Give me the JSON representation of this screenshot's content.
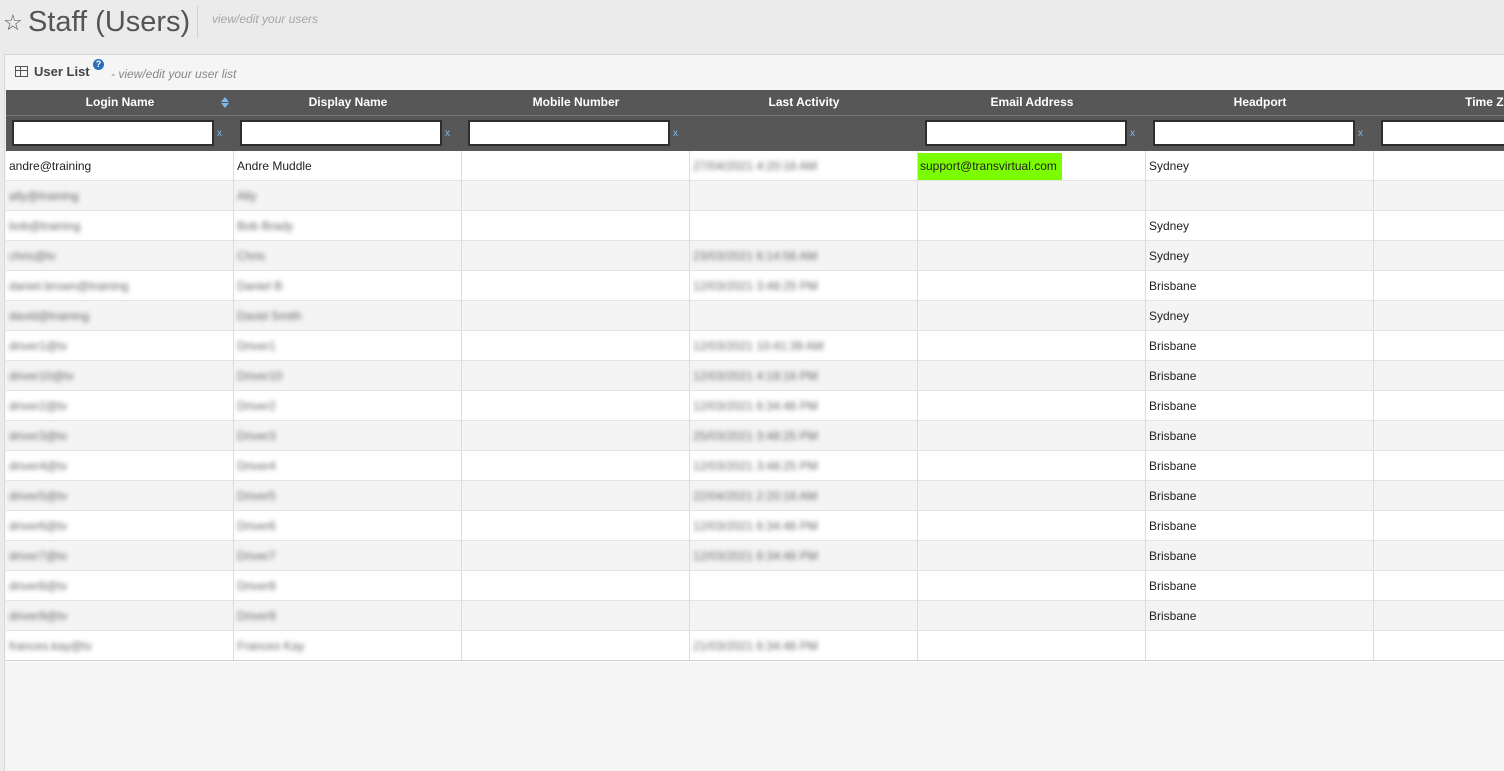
{
  "page": {
    "title": "Staff (Users)",
    "subtitle": "view/edit your users",
    "star_icon": "star-icon"
  },
  "panel": {
    "title": "User List",
    "subtitle": "- view/edit your user list",
    "help_icon": "?"
  },
  "columns": [
    "Login Name",
    "Display Name",
    "Mobile Number",
    "Last Activity",
    "Email Address",
    "Headport",
    "Time Zo"
  ],
  "filter_clear": "x",
  "colors": {
    "header_bg": "#575757",
    "highlight": "#7cfc00",
    "accent": "#2a6ebb"
  },
  "rows": [
    {
      "login": "andre@training",
      "display": "Andre Muddle",
      "mobile": "",
      "activity": "27/04/2021 4:20:16 AM",
      "email": "support@transvirtual.com",
      "headport": "Sydney"
    },
    {
      "login": "ally@training",
      "display": "Ally",
      "mobile": "",
      "activity": "",
      "email": "",
      "headport": ""
    },
    {
      "login": "bob@training",
      "display": "Bob Brady",
      "mobile": "",
      "activity": "",
      "email": "",
      "headport": "Sydney"
    },
    {
      "login": "chris@tv",
      "display": "Chris",
      "mobile": "",
      "activity": "23/03/2021 6:14:56 AM",
      "email": "",
      "headport": "Sydney"
    },
    {
      "login": "daniel.brown@training",
      "display": "Daniel B",
      "mobile": "",
      "activity": "12/03/2021 3:48:25 PM",
      "email": "",
      "headport": "Brisbane"
    },
    {
      "login": "david@training",
      "display": "David Smith",
      "mobile": "",
      "activity": "",
      "email": "",
      "headport": "Sydney"
    },
    {
      "login": "driver1@tv",
      "display": "Driver1",
      "mobile": "",
      "activity": "12/03/2021 10:41:39 AM",
      "email": "",
      "headport": "Brisbane"
    },
    {
      "login": "driver10@tv",
      "display": "Driver10",
      "mobile": "",
      "activity": "12/03/2021 4:18:16 PM",
      "email": "",
      "headport": "Brisbane"
    },
    {
      "login": "driver2@tv",
      "display": "Driver2",
      "mobile": "",
      "activity": "12/03/2021 6:34:46 PM",
      "email": "",
      "headport": "Brisbane"
    },
    {
      "login": "driver3@tv",
      "display": "Driver3",
      "mobile": "",
      "activity": "25/03/2021 3:48:25 PM",
      "email": "",
      "headport": "Brisbane"
    },
    {
      "login": "driver4@tv",
      "display": "Driver4",
      "mobile": "",
      "activity": "12/03/2021 3:48:25 PM",
      "email": "",
      "headport": "Brisbane"
    },
    {
      "login": "driver5@tv",
      "display": "Driver5",
      "mobile": "",
      "activity": "22/04/2021 2:20:16 AM",
      "email": "",
      "headport": "Brisbane"
    },
    {
      "login": "driver6@tv",
      "display": "Driver6",
      "mobile": "",
      "activity": "12/03/2021 6:34:46 PM",
      "email": "",
      "headport": "Brisbane"
    },
    {
      "login": "driver7@tv",
      "display": "Driver7",
      "mobile": "",
      "activity": "12/03/2021 6:34:46 PM",
      "email": "",
      "headport": "Brisbane"
    },
    {
      "login": "driver8@tv",
      "display": "Driver8",
      "mobile": "",
      "activity": "",
      "email": "",
      "headport": "Brisbane"
    },
    {
      "login": "driver9@tv",
      "display": "Driver9",
      "mobile": "",
      "activity": "",
      "email": "",
      "headport": "Brisbane"
    },
    {
      "login": "frances.kay@tv",
      "display": "Frances Kay",
      "mobile": "",
      "activity": "21/03/2021 6:34:46 PM",
      "email": "",
      "headport": ""
    }
  ]
}
